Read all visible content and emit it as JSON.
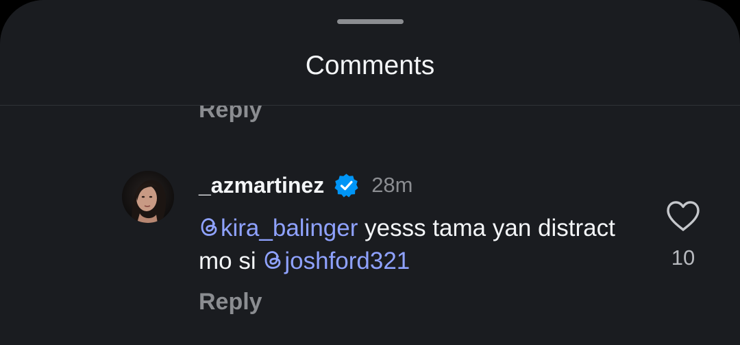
{
  "header": {
    "title": "Comments"
  },
  "previous_comment": {
    "reply_label": "Reply"
  },
  "comment": {
    "avatar_icon": "user-avatar-photo",
    "username": "_azmartinez",
    "verified_icon": "verified-badge-icon",
    "verified_color": "#0095f6",
    "time": "28m",
    "segments": [
      {
        "type": "mention",
        "text": "kira_balinger"
      },
      {
        "type": "text",
        "text": " yesss tama yan distract mo si "
      },
      {
        "type": "mention",
        "text": "joshford321"
      }
    ],
    "mention_color": "#8fa2ff",
    "reply_label": "Reply",
    "like_icon": "heart-outline-icon",
    "like_count": "10"
  }
}
